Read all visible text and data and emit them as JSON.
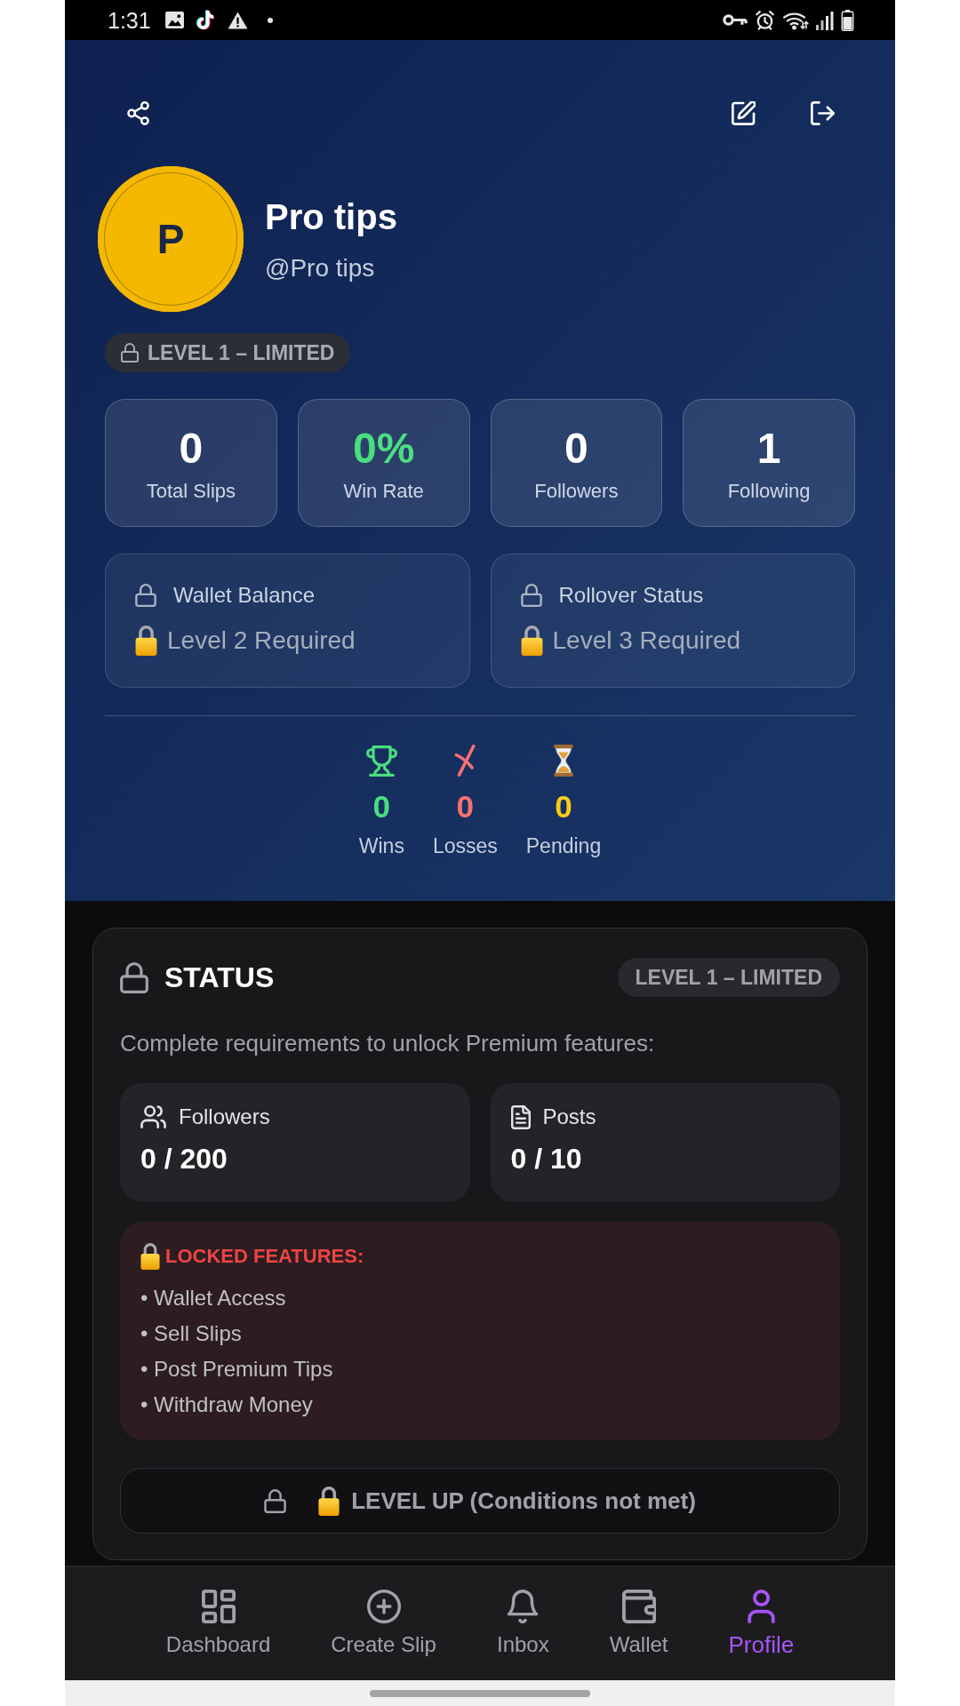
{
  "status_bar": {
    "time": "1:31"
  },
  "profile": {
    "initial": "P",
    "name": "Pro tips",
    "handle": "@Pro tips",
    "level_badge": "LEVEL 1 – LIMITED"
  },
  "stats": [
    {
      "value": "0",
      "label": "Total Slips",
      "color": "#ffffff"
    },
    {
      "value": "0%",
      "label": "Win Rate",
      "color": "#4ade80"
    },
    {
      "value": "0",
      "label": "Followers",
      "color": "#ffffff"
    },
    {
      "value": "1",
      "label": "Following",
      "color": "#ffffff"
    }
  ],
  "locked_cards": [
    {
      "title": "Wallet Balance",
      "note": "Level 2 Required"
    },
    {
      "title": "Rollover Status",
      "note": "Level 3 Required"
    }
  ],
  "results": [
    {
      "kind": "wins",
      "value": "0",
      "label": "Wins",
      "color": "#4ade80"
    },
    {
      "kind": "losses",
      "value": "0",
      "label": "Losses",
      "color": "#f87171"
    },
    {
      "kind": "pending",
      "value": "0",
      "label": "Pending",
      "color": "#facc15"
    }
  ],
  "status": {
    "title": "STATUS",
    "badge": "LEVEL 1 – LIMITED",
    "intro": "Complete requirements to unlock Premium features:",
    "requirements": [
      {
        "kind": "followers",
        "label": "Followers",
        "value": "0 / 200"
      },
      {
        "kind": "posts",
        "label": "Posts",
        "value": "0 / 10"
      }
    ],
    "locked_features": {
      "title": "LOCKED FEATURES:",
      "items": [
        "• Wallet Access",
        "• Sell Slips",
        "• Post Premium Tips",
        "• Withdraw Money"
      ]
    },
    "level_up": {
      "label": "LEVEL UP (Conditions not met)",
      "disabled": true
    }
  },
  "nav": [
    {
      "label": "Dashboard",
      "selected": false
    },
    {
      "label": "Create Slip",
      "selected": false
    },
    {
      "label": "Inbox",
      "selected": false
    },
    {
      "label": "Wallet",
      "selected": false
    },
    {
      "label": "Profile",
      "selected": true
    }
  ]
}
